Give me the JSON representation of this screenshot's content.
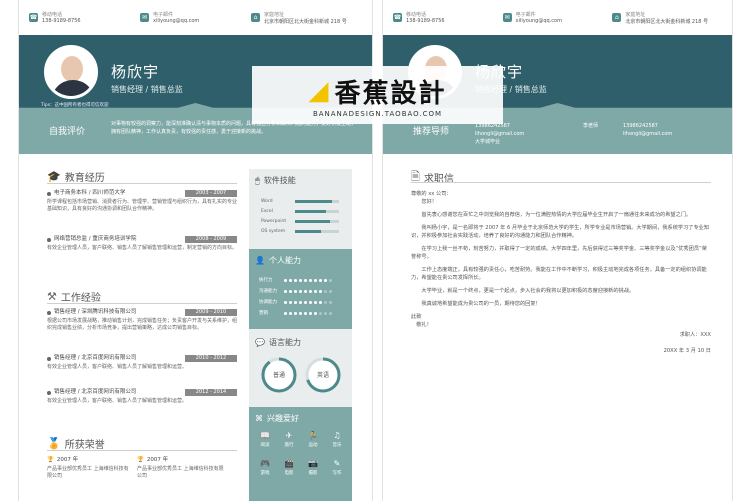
{
  "contact": {
    "phone_label": "移动电话",
    "phone": "138-9189-8756",
    "email_label": "电子邮件",
    "email": "xiliyoung@qq.com",
    "address_label": "家庭地址",
    "address": "北京市朝阳区北大街金科新城 218 号"
  },
  "profile": {
    "name": "杨欣宇",
    "role": "销售经理 / 销售总监",
    "tips": "Tips：这中国所有者也得可信欢迎"
  },
  "self_eval": {
    "title": "自我评价",
    "text": "对事物有较强的洞察力，能深刻准确认清与事物本质的问题，具有独立分析和解决问题的能力；爱好积极主动，拥有团队精神，工作认真负责，有较强的责任感，勇于迎接新的挑战。"
  },
  "education": {
    "title": "教育经历",
    "items": [
      {
        "head": "电子商务本科 / 四川师范大学",
        "dates": "2003 - 2007",
        "text": "所学课程包括市场营销、消费者行为、管理学、营销管理与组织行为，具有扎实的专业基础知识，具有良好的沟通协调和团队合作精神。"
      },
      {
        "head": "网络营销总监 / 重庆商务培训学院",
        "dates": "2008 - 2009",
        "text": "有效企业管理人员，客户联络、销售人员了解销售管理和运营，制定营销的方向目标。"
      }
    ]
  },
  "work": {
    "title": "工作经验",
    "items": [
      {
        "head": "销售经理 / 深圳腾讯科技有限公司",
        "dates": "2009 - 2010",
        "text": "根据公司市场发展战略，推动销售计划，完成销售任务；负责客户开发与关系维护，组织完成销售业绩，分析市场竞争，提出营销策略，达成公司销售目标。"
      },
      {
        "head": "销售经理 / 北京百度网讯有限公司",
        "dates": "2010 - 2012",
        "text": "有效企业管理人员，客户联络、销售人员了解销售管理和运营。"
      },
      {
        "head": "销售经理 / 北京百度网讯有限公司",
        "dates": "2012 - 2014",
        "text": "有效企业管理人员，客户联络、销售人员了解销售管理和运营。"
      }
    ]
  },
  "honors": {
    "title": "所获荣誉",
    "items": [
      {
        "year": "2007 年",
        "text": "产品事业部优秀员工 上海维信科技有限公司"
      },
      {
        "year": "2007 年",
        "text": "产品事业部优秀员工 上海维信科技有限公司"
      }
    ]
  },
  "skills": {
    "title": "软件技能",
    "items": [
      {
        "name": "Word",
        "level": 0.85
      },
      {
        "name": "Excel",
        "level": 0.7
      },
      {
        "name": "Powerpoint",
        "level": 0.8
      },
      {
        "name": "OS system",
        "level": 0.6
      }
    ]
  },
  "abilities": {
    "title": "个人能力",
    "items": [
      {
        "name": "执行力",
        "level": 9
      },
      {
        "name": "沟通能力",
        "level": 8
      },
      {
        "name": "协调能力",
        "level": 8
      },
      {
        "name": "营销",
        "level": 7
      }
    ]
  },
  "languages": {
    "title": "语言能力",
    "items": [
      {
        "name": "普通",
        "level": 0.9
      },
      {
        "name": "英语",
        "level": 0.7
      }
    ]
  },
  "hobbies": {
    "title": "兴趣爱好",
    "items": [
      "阅读",
      "旅行",
      "运动",
      "音乐",
      "游戏",
      "电影",
      "摄影",
      "写作"
    ]
  },
  "letter": {
    "section_title": "求职信",
    "salutation": "尊敬的 xx 公司：",
    "greeting": "您好！",
    "paragraphs": [
      "首先衷心感谢您在百忙之中浏览我的自荐信，为一位满腔热情的大学应届毕业生开启了一扇通往未来成功的希望之门。",
      "我叫杨小宇，是一名即将于 2007 年 6 月毕业于北京师范大学的学生，所学专业是市场营销。大学期间，我系统学习了专业知识，并积极参加社会实践活动，培养了良好的沟通能力和团队合作精神。",
      "在学习上我一丝不苟，刻苦努力，并取得了一定的成绩。大学四年里，先后获得过三等奖学金、三等奖学金以及“优秀团员”荣誉称号。",
      "工作上态度端正，具有较强的责任心，吃苦耐劳。我能在工作中不断学习，积极主动地完成各项任务，具备一定的组织协调能力，希望能在贵公司发挥所长。",
      "大学毕业，就是一个终点，更是一个起点，步入社会的我将以更加积极的态度迎接新的挑战。"
    ],
    "closing": "我真诚地希望能成为贵公司的一员，期待您的回复！",
    "salute": "此致",
    "respect": "敬礼！",
    "signature": "求职人：XXX",
    "date": "20XX 年 3 月 10 日"
  },
  "right_header": {
    "title": "推荐导师",
    "phone": "13986242587",
    "email": "lihongli@gmail.com",
    "unit_label": "大学城毕业",
    "phone_b": "13986242587",
    "email_b": "lihongli@gmail.com",
    "tutor": "李老师"
  },
  "watermark": {
    "brand": "香蕉設計",
    "site": "BANANADESIGN.TAOBAO.COM"
  }
}
